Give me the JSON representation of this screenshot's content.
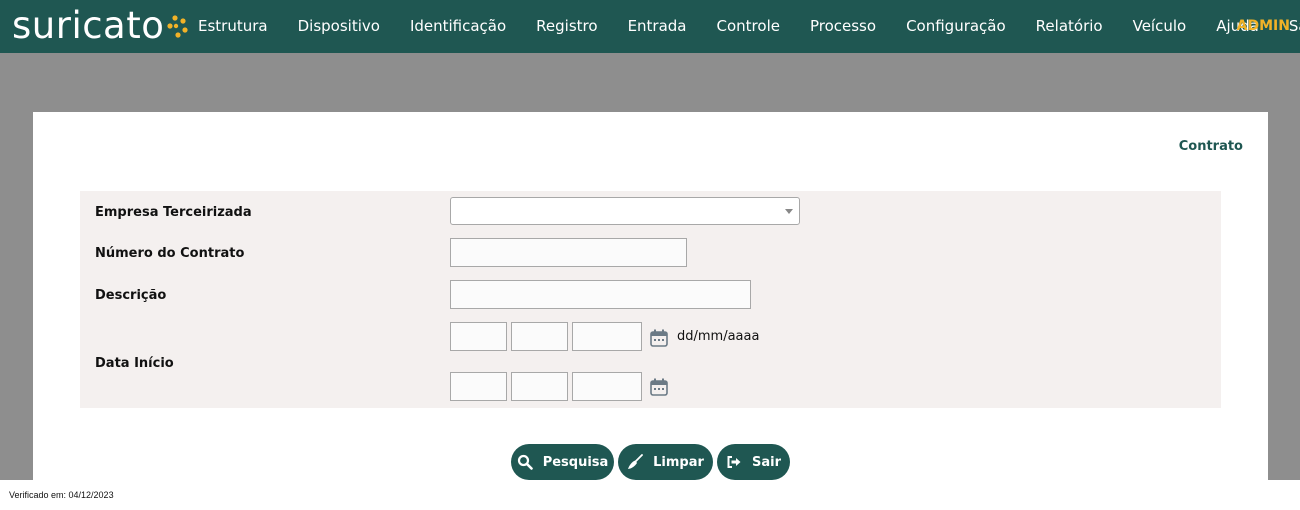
{
  "header": {
    "logo_text": "suricato",
    "nav": [
      "Estrutura",
      "Dispositivo",
      "Identificação",
      "Registro",
      "Entrada",
      "Controle",
      "Processo",
      "Configuração",
      "Relatório",
      "Veículo",
      "Ajuda",
      "Sair"
    ],
    "user": "ADMIN"
  },
  "page": {
    "title": "Contrato"
  },
  "form": {
    "empresa_label": "Empresa Terceirizada",
    "empresa_value": "",
    "numero_label": "Número do Contrato",
    "numero_value": "",
    "descricao_label": "Descrição",
    "descricao_value": "",
    "data_inicio_label": "Data Início",
    "date_format_hint": "dd/mm/aaaa",
    "date_start": {
      "day": "",
      "month": "",
      "year": ""
    },
    "date_end": {
      "day": "",
      "month": "",
      "year": ""
    }
  },
  "buttons": {
    "search": "Pesquisa",
    "clear": "Limpar",
    "exit": "Sair"
  },
  "footer": {
    "verified": "Verificado em: 04/12/2023"
  },
  "colors": {
    "primary": "#1f5752",
    "accent": "#f2b227",
    "form_bg": "#f4f0ef",
    "page_bg": "#8e8e8e"
  }
}
